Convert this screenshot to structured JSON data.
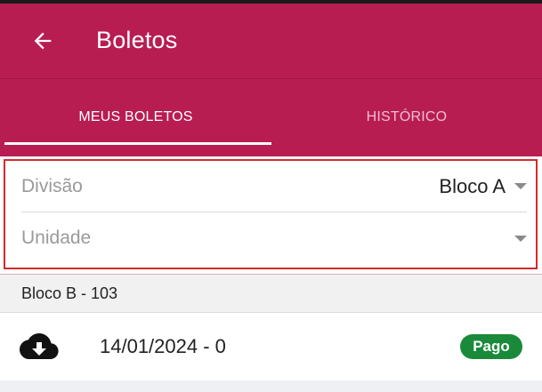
{
  "header": {
    "title": "Boletos",
    "back_icon": "arrow-left-icon",
    "background": "#b81d52"
  },
  "tabs": [
    {
      "label": "MEUS BOLETOS",
      "active": true
    },
    {
      "label": "HISTÓRICO",
      "active": false
    }
  ],
  "filters": {
    "divisao": {
      "label": "Divisão",
      "value": "Bloco A"
    },
    "unidade": {
      "label": "Unidade",
      "value": ""
    }
  },
  "groups": [
    {
      "title": "Bloco B - 103",
      "items": [
        {
          "icon": "cloud-download-icon",
          "date": "14/01/2024 - 0",
          "status": "Pago",
          "status_color": "#1a8a3a"
        }
      ]
    }
  ]
}
